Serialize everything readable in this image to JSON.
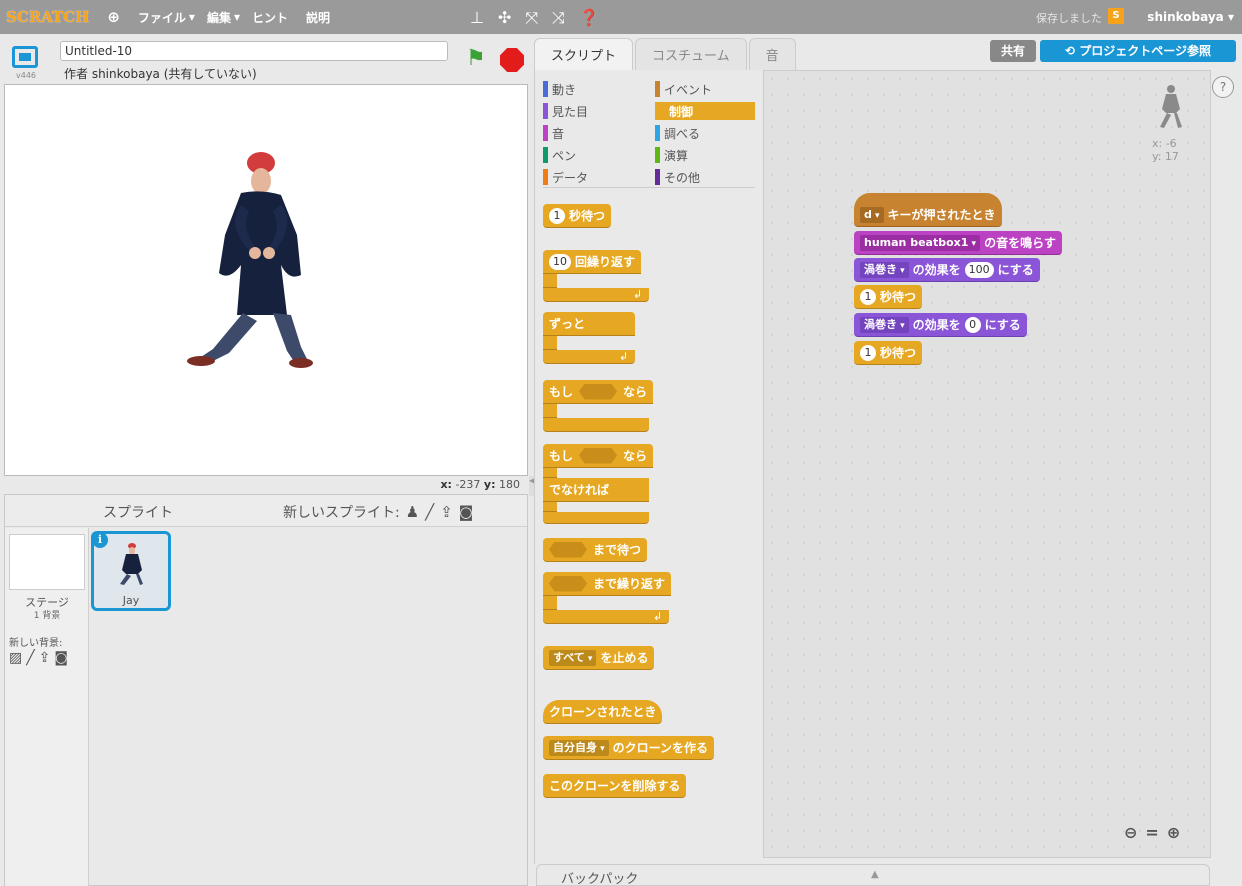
{
  "menubar": {
    "logo": "SCRATCH",
    "items": [
      {
        "label": "ファイル",
        "has_dropdown": true
      },
      {
        "label": "編集",
        "has_dropdown": true
      },
      {
        "label": "ヒント",
        "has_dropdown": false
      },
      {
        "label": "説明",
        "has_dropdown": false
      }
    ],
    "tools": [
      "copy-tool-icon",
      "cut-tool-icon",
      "grow-tool-icon",
      "shrink-tool-icon",
      "help-tool-icon"
    ],
    "save_status": "保存しました",
    "user_name": "shinkobaya",
    "user_icon_letter": "S"
  },
  "stage_header": {
    "version": "v446",
    "project_title": "Untitled-10",
    "author": "作者 shinkobaya (共有していない)"
  },
  "stage": {
    "coords_x_label": "x:",
    "coords_x": "-237",
    "coords_y_label": "y:",
    "coords_y": "180"
  },
  "sprite_panel": {
    "title": "スプライト",
    "new_sprite_label": "新しいスプライト:",
    "stage_label": "ステージ",
    "stage_sub": "1 背景",
    "new_backdrop_label": "新しい背景:",
    "sprites": [
      {
        "name": "Jay"
      }
    ]
  },
  "tabs": [
    {
      "label": "スクリプト",
      "active": true
    },
    {
      "label": "コスチューム",
      "active": false
    },
    {
      "label": "音",
      "active": false
    }
  ],
  "top_right": {
    "share": "共有",
    "project_page": "プロジェクトページ参照"
  },
  "categories": [
    {
      "label": "動き",
      "color": "#4a6cd4"
    },
    {
      "label": "イベント",
      "color": "#c88330"
    },
    {
      "label": "見た目",
      "color": "#8a55d7"
    },
    {
      "label": "制御",
      "color": "#e6a822",
      "selected": true
    },
    {
      "label": "音",
      "color": "#bb42c3"
    },
    {
      "label": "調べる",
      "color": "#2ca5e2"
    },
    {
      "label": "ペン",
      "color": "#0e9a6c"
    },
    {
      "label": "演算",
      "color": "#5cb712"
    },
    {
      "label": "データ",
      "color": "#ee7d16"
    },
    {
      "label": "その他",
      "color": "#632d99"
    }
  ],
  "palette_blocks": {
    "wait": {
      "num": "1",
      "label": "秒待つ"
    },
    "repeat": {
      "num": "10",
      "label": "回繰り返す"
    },
    "forever": {
      "label": "ずっと"
    },
    "if_then": {
      "prefix": "もし",
      "suffix": "なら"
    },
    "if_else": {
      "prefix": "もし",
      "suffix": "なら",
      "else": "でなければ"
    },
    "wait_until": {
      "label": "まで待つ"
    },
    "repeat_until": {
      "label": "まで繰り返す"
    },
    "stop": {
      "dropdown": "すべて",
      "label": "を止める"
    },
    "clone_start": {
      "label": "クローンされたとき"
    },
    "create_clone": {
      "dropdown": "自分自身",
      "label": "のクローンを作る"
    },
    "delete_clone": {
      "label": "このクローンを削除する"
    }
  },
  "script": {
    "when_key": {
      "key": "d",
      "label": "キーが押されたとき"
    },
    "play_sound": {
      "sound": "human beatbox1",
      "label": "の音を鳴らす"
    },
    "set_effect1": {
      "effect": "渦巻き",
      "label": "の効果を",
      "value": "100",
      "suffix": "にする"
    },
    "wait1": {
      "num": "1",
      "label": "秒待つ"
    },
    "set_effect2": {
      "effect": "渦巻き",
      "label": "の効果を",
      "value": "0",
      "suffix": "にする"
    },
    "wait2": {
      "num": "1",
      "label": "秒待つ"
    },
    "sprite_x": "x: -6",
    "sprite_y": "y: 17"
  },
  "zoom_icons": [
    "zoom-out-icon",
    "zoom-reset-icon",
    "zoom-in-icon"
  ],
  "backpack": {
    "label": "バックパック"
  }
}
